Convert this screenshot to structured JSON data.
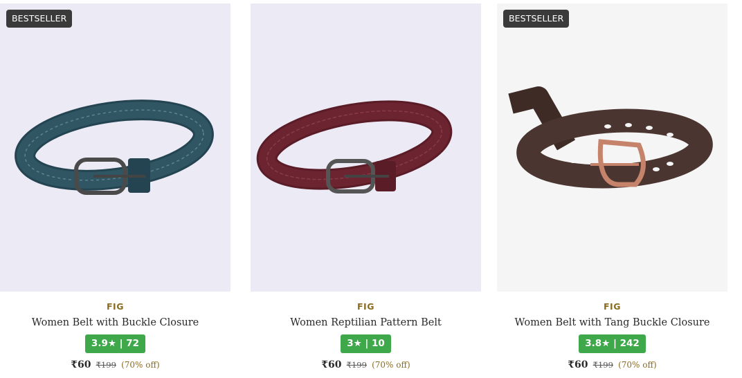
{
  "products": [
    {
      "badge": "",
      "brand": "FIG",
      "title": "Women Reptilian Pattern Belt",
      "rating": "3★ | 10",
      "price": "₹60",
      "mrp": "₹199",
      "discount": "(70% off)",
      "image_bg": "#eceaf5",
      "belt_color": "#6b2430",
      "image_icon": "belt-reptilian-maroon"
    },
    {
      "badge": "BESTSELLER",
      "brand": "FIG",
      "title": "Women Belt with Tang Buckle Closure",
      "rating": "3.8★ | 242",
      "price": "₹60",
      "mrp": "₹199",
      "discount": "(70% off)",
      "image_bg": "#f5f5f5",
      "belt_color": "#4a3530",
      "image_icon": "belt-perforated-brown"
    },
    {
      "badge": "BESTSELLER",
      "brand": "FIG",
      "title": "Women Belt with Buckle Closure",
      "rating": "3.9★ | 72",
      "price": "₹60",
      "mrp": "₹199",
      "discount": "(70% off)",
      "image_bg": "#eceaf5",
      "belt_color": "#2f5662",
      "image_icon": "belt-reptilian-teal"
    }
  ]
}
